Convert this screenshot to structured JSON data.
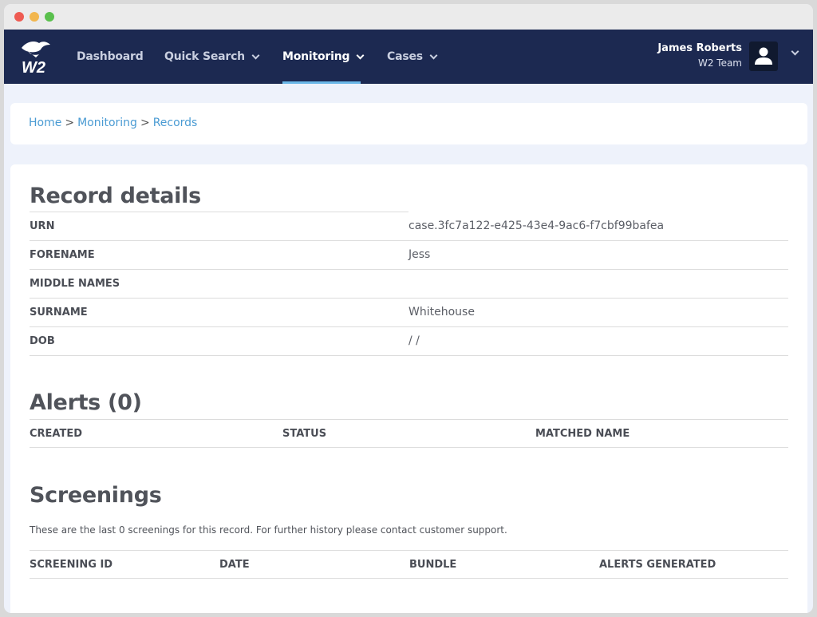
{
  "nav": {
    "items": [
      {
        "label": "Dashboard"
      },
      {
        "label": "Quick Search"
      },
      {
        "label": "Monitoring"
      },
      {
        "label": "Cases"
      }
    ],
    "logo_text": "W2",
    "user": {
      "name": "James Roberts",
      "team": "W2 Team"
    }
  },
  "breadcrumb": {
    "items": [
      "Home",
      "Monitoring",
      "Records"
    ],
    "separator": ">"
  },
  "record": {
    "title": "Record details",
    "rows": [
      {
        "label": "URN",
        "value": "case.3fc7a122-e425-43e4-9ac6-f7cbf99bafea"
      },
      {
        "label": "FORENAME",
        "value": "Jess"
      },
      {
        "label": "MIDDLE NAMES",
        "value": ""
      },
      {
        "label": "SURNAME",
        "value": "Whitehouse"
      },
      {
        "label": "DOB",
        "value": "/ /"
      }
    ]
  },
  "alerts": {
    "title": "Alerts (0)",
    "columns": [
      "CREATED",
      "STATUS",
      "MATCHED NAME"
    ]
  },
  "screenings": {
    "title": "Screenings",
    "note": "These are the last 0 screenings for this record. For further history please contact customer support.",
    "columns": [
      "SCREENING ID",
      "DATE",
      "BUNDLE",
      "ALERTS GENERATED"
    ]
  },
  "colors": {
    "navbar": "#1c2951",
    "accent": "#6bb8e8",
    "link": "#4a9bd3",
    "page_bg": "#eef2fb"
  },
  "icons": [
    "w2-eagle-logo",
    "chevron-down-icon",
    "user-avatar-icon"
  ]
}
